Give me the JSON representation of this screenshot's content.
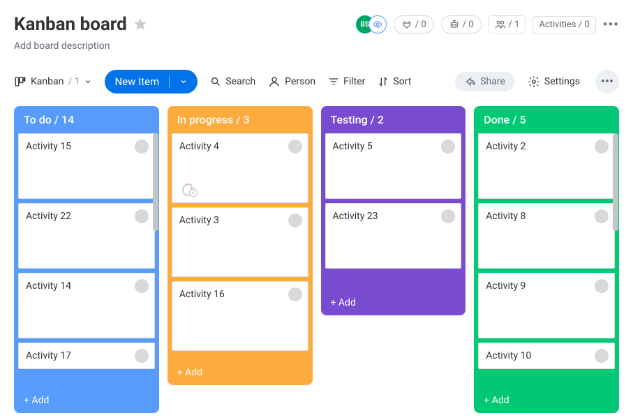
{
  "header": {
    "title": "Kanban board",
    "description": "Add board description",
    "avatar_initials": "BS",
    "automation_count": "/ 0",
    "integration_count": "/ 0",
    "people_count": "/ 1",
    "activities_label": "Activities / 0"
  },
  "toolbar": {
    "view_label": "Kanban",
    "view_count": "/ 1",
    "new_item_label": "New Item",
    "search_label": "Search",
    "person_label": "Person",
    "filter_label": "Filter",
    "sort_label": "Sort",
    "share_label": "Share",
    "settings_label": "Settings"
  },
  "columns": [
    {
      "key": "todo",
      "title": "To do / 14",
      "add_label": "+ Add",
      "cards": [
        {
          "title": "Activity 15",
          "comments": null
        },
        {
          "title": "Activity 22",
          "comments": null
        },
        {
          "title": "Activity 14",
          "comments": null
        },
        {
          "title": "Activity 17",
          "comments": null,
          "short": true
        }
      ]
    },
    {
      "key": "progress",
      "title": "In progress / 3",
      "add_label": "+ Add",
      "cards": [
        {
          "title": "Activity 4",
          "comments": 2
        },
        {
          "title": "Activity 3",
          "comments": null
        },
        {
          "title": "Activity 16",
          "comments": null
        }
      ]
    },
    {
      "key": "testing",
      "title": "Testing / 2",
      "add_label": "+ Add",
      "cards": [
        {
          "title": "Activity 5",
          "comments": null
        },
        {
          "title": "Activity 23",
          "comments": null
        }
      ]
    },
    {
      "key": "done",
      "title": "Done / 5",
      "add_label": "+ Add",
      "cards": [
        {
          "title": "Activity 2",
          "comments": null
        },
        {
          "title": "Activity 8",
          "comments": null
        },
        {
          "title": "Activity 9",
          "comments": null
        },
        {
          "title": "Activity 10",
          "comments": null,
          "short": true
        }
      ]
    }
  ]
}
